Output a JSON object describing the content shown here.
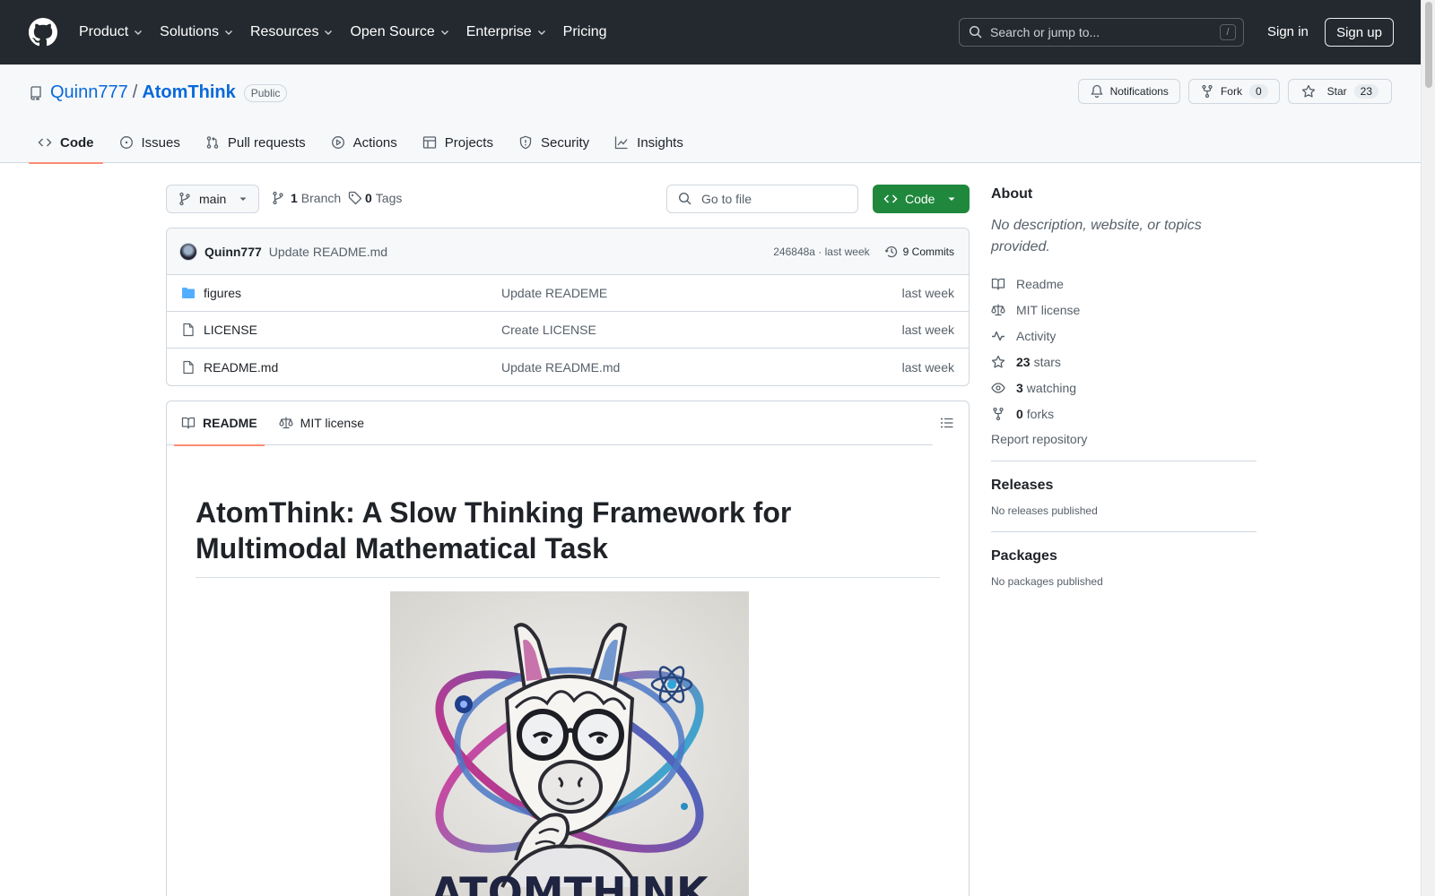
{
  "header": {
    "nav": [
      {
        "label": "Product",
        "dropdown": true
      },
      {
        "label": "Solutions",
        "dropdown": true
      },
      {
        "label": "Resources",
        "dropdown": true
      },
      {
        "label": "Open Source",
        "dropdown": true
      },
      {
        "label": "Enterprise",
        "dropdown": true
      },
      {
        "label": "Pricing",
        "dropdown": false
      }
    ],
    "search_placeholder": "Search or jump to...",
    "search_key": "/",
    "sign_in": "Sign in",
    "sign_up": "Sign up"
  },
  "repo": {
    "owner": "Quinn777",
    "separator": "/",
    "name": "AtomThink",
    "visibility": "Public",
    "notifications_label": "Notifications",
    "fork_label": "Fork",
    "fork_count": "0",
    "star_label": "Star",
    "star_count": "23",
    "tabs": [
      "Code",
      "Issues",
      "Pull requests",
      "Actions",
      "Projects",
      "Security",
      "Insights"
    ],
    "active_tab": "Code"
  },
  "toolbar": {
    "branch": "main",
    "branch_count": "1",
    "branch_label": "Branch",
    "tag_count": "0",
    "tag_label": "Tags",
    "goto_file": "Go to file",
    "code_button": "Code"
  },
  "commit": {
    "author": "Quinn777",
    "message": "Update README.md",
    "meta": "246848a · last week",
    "commits": "9 Commits"
  },
  "files": [
    {
      "type": "folder",
      "name": "figures",
      "message": "Update READEME",
      "date": "last week"
    },
    {
      "type": "file",
      "name": "LICENSE",
      "message": "Create LICENSE",
      "date": "last week"
    },
    {
      "type": "file",
      "name": "README.md",
      "message": "Update README.md",
      "date": "last week"
    }
  ],
  "readme": {
    "tabs": [
      "README",
      "MIT license"
    ],
    "heading": "AtomThink: A Slow Thinking Framework for Multimodal Mathematical Task",
    "logo_text": "ATOMTHINK"
  },
  "sidebar": {
    "about_title": "About",
    "about_desc": "No description, website, or topics provided.",
    "links": {
      "readme": "Readme",
      "license": "MIT license",
      "activity": "Activity",
      "stars_count": "23",
      "stars_label": "stars",
      "watching_count": "3",
      "watching_label": "watching",
      "forks_count": "0",
      "forks_label": "forks"
    },
    "report": "Report repository",
    "releases_title": "Releases",
    "releases_text": "No releases published",
    "packages_title": "Packages",
    "packages_text": "No packages published"
  },
  "colors": {
    "header_bg": "#24292f",
    "link": "#0969da",
    "primary_button": "#1f883d",
    "tab_underline": "#fd8c73",
    "folder_icon": "#54aeff"
  }
}
